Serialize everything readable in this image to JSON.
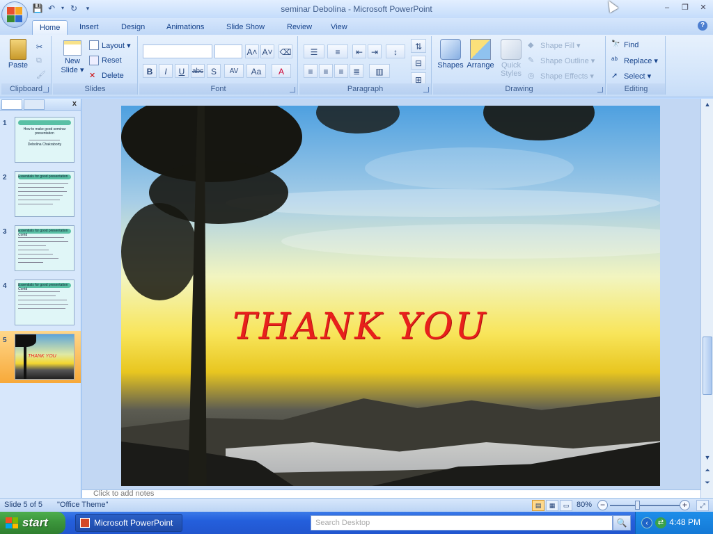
{
  "window": {
    "title": "seminar Debolina - Microsoft PowerPoint",
    "minimize": "–",
    "maximize": "❐",
    "close": "✕"
  },
  "ribbon_tabs": [
    "Home",
    "Insert",
    "Design",
    "Animations",
    "Slide Show",
    "Review",
    "View"
  ],
  "ribbon": {
    "clipboard": {
      "label": "Clipboard",
      "paste": "Paste"
    },
    "slides": {
      "label": "Slides",
      "new_slide_line1": "New",
      "new_slide_line2": "Slide ▾",
      "layout": "Layout ▾",
      "reset": "Reset",
      "delete": "Delete"
    },
    "font": {
      "label": "Font",
      "grow": "A˄",
      "shrink": "A˅",
      "bold": "B",
      "italic": "I",
      "underline": "U",
      "strike": "abc",
      "shadow": "S",
      "spacing": "AV",
      "case": "Aa",
      "color": "A"
    },
    "paragraph": {
      "label": "Paragraph"
    },
    "drawing": {
      "label": "Drawing",
      "shapes": "Shapes",
      "arrange": "Arrange",
      "quick_styles_line1": "Quick",
      "quick_styles_line2": "Styles",
      "shape_fill": "Shape Fill ▾",
      "shape_outline": "Shape Outline ▾",
      "shape_effects": "Shape Effects ▾"
    },
    "editing": {
      "label": "Editing",
      "find": "Find",
      "replace": "Replace ▾",
      "select": "Select ▾"
    }
  },
  "slides_pane": {
    "close": "x",
    "slides": [
      {
        "num": "1",
        "title": "How to make good seminar presentation",
        "sub": "Debolina Chakraborty"
      },
      {
        "num": "2",
        "title": "Essentials for good presentation"
      },
      {
        "num": "3",
        "title": "Essentials for good presentation Contd"
      },
      {
        "num": "4",
        "title": "Essentials for good presentation Contd"
      },
      {
        "num": "5",
        "title": "THANK YOU"
      }
    ]
  },
  "slide": {
    "text": "THANK YOU"
  },
  "notes": {
    "placeholder": "Click to add notes"
  },
  "status": {
    "slide_pos": "Slide 5 of 5",
    "theme": "\"Office Theme\"",
    "zoom": "80%",
    "zoom_level": 0.4
  },
  "taskbar": {
    "start": "start",
    "task_item": "Microsoft PowerPoint ...",
    "search_placeholder": "Search Desktop",
    "clock": "4:48 PM"
  }
}
